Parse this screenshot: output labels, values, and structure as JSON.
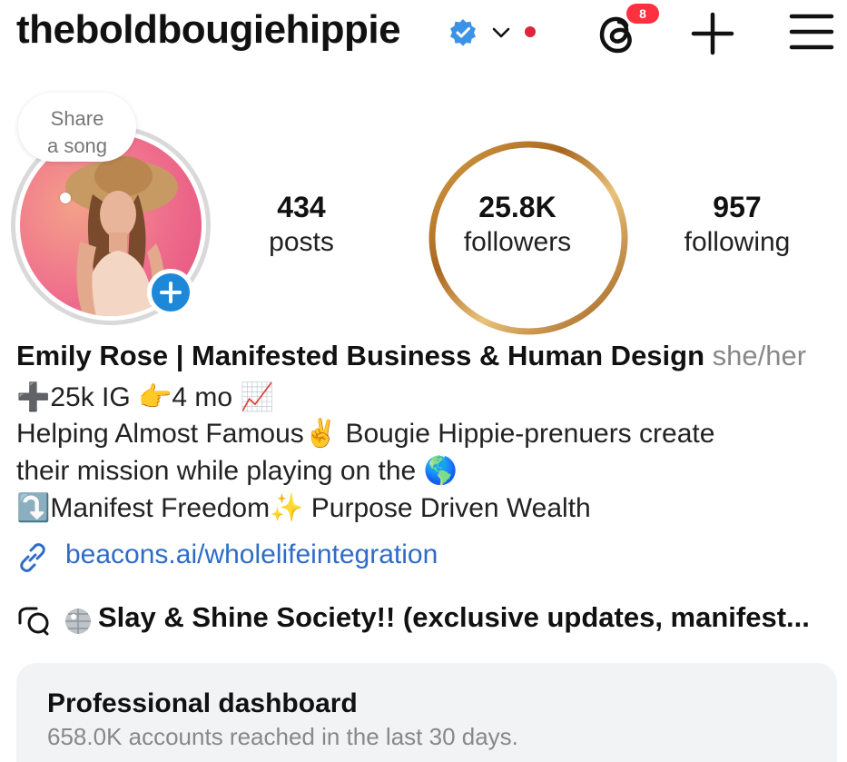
{
  "header": {
    "username": "theboldbougiehippie",
    "notification_badge": "8",
    "colors": {
      "verified": "#3b93e8",
      "notification_dot": "#e0243a"
    }
  },
  "avatar": {
    "note_prompt_line1": "Share",
    "note_prompt_line2": "a song",
    "add_story_color": "#1e88d8"
  },
  "stats": [
    {
      "value": "434",
      "label": "posts"
    },
    {
      "value": "25.8K",
      "label": "followers"
    },
    {
      "value": "957",
      "label": "following"
    }
  ],
  "bio": {
    "name": "Emily Rose | Manifested Business & Human Design",
    "pronouns": "she/her",
    "line1": "➕25k IG 👉4 mo 📈",
    "line2": "Helping Almost Famous✌️ Bougie Hippie-prenuers create",
    "line3": "their mission while playing on the 🌎",
    "line4": "⤵️Manifest Freedom✨ Purpose Driven Wealth",
    "link": "beacons.ai/wholelifeintegration",
    "link_color": "#2e6cc7"
  },
  "channel": {
    "text": "Slay & Shine Society!! (exclusive updates, manifest..."
  },
  "dashboard": {
    "title": "Professional dashboard",
    "subtitle": "658.0K accounts reached in the last 30 days."
  }
}
